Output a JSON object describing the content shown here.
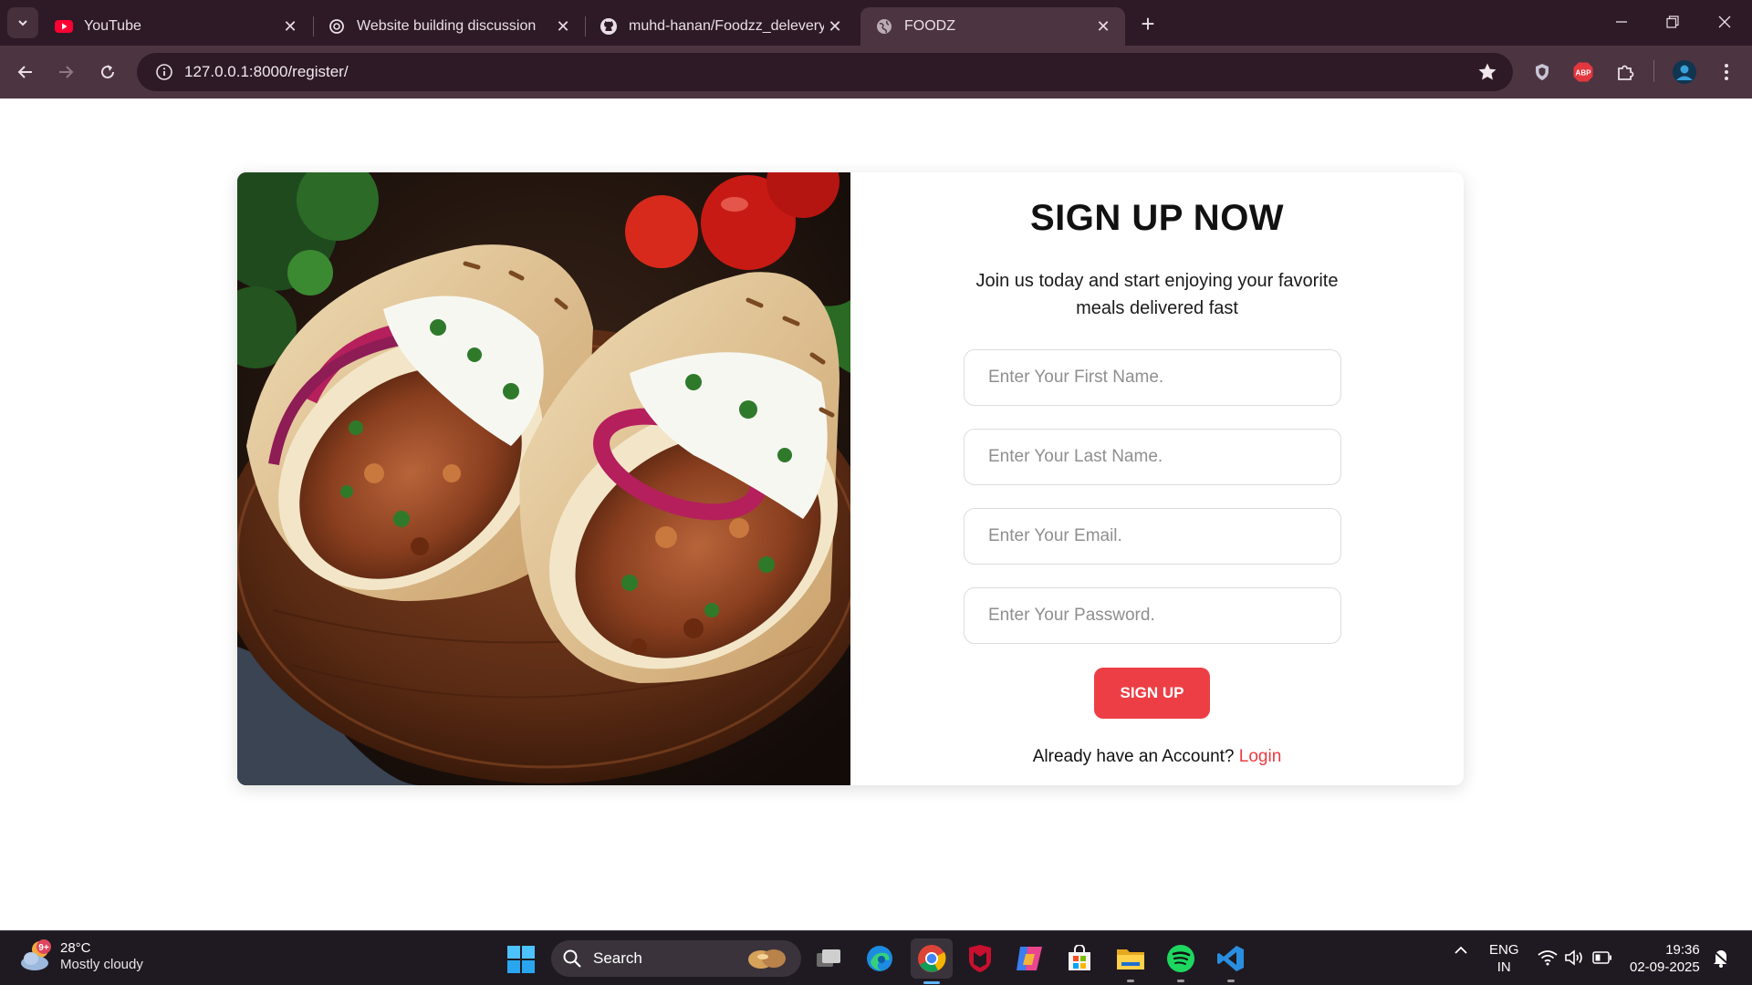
{
  "browser": {
    "tabs": [
      {
        "title": "YouTube",
        "icon": "youtube-icon"
      },
      {
        "title": "Website building discussion",
        "icon": "chatgpt-icon"
      },
      {
        "title": "muhd-hanan/Foodzz_delevery",
        "icon": "github-icon"
      },
      {
        "title": "FOODZ",
        "icon": "globe-icon",
        "active": true
      }
    ],
    "url": "127.0.0.1:8000/register/",
    "extensions": [
      "shield-extension-icon",
      "adblock-plus-icon",
      "extensions-puzzle-icon",
      "profile-avatar",
      "more-menu-icon"
    ],
    "abp_label": "ABP"
  },
  "page": {
    "title": "SIGN UP NOW",
    "subtitle": "Join us today and start enjoying your favorite meals delivered fast",
    "fields": {
      "first_name_placeholder": "Enter Your First Name.",
      "last_name_placeholder": "Enter Your Last Name.",
      "email_placeholder": "Enter Your Email.",
      "password_placeholder": "Enter Your Password."
    },
    "signup_button": "SIGN UP",
    "login_prompt": "Already have an Account?",
    "login_link": "Login",
    "colors": {
      "accent": "#ee3e45",
      "link": "#e93c42"
    },
    "image_subject": "chicken shawarma wraps on wooden board"
  },
  "taskbar": {
    "weather": {
      "temp": "28°C",
      "condition": "Mostly cloudy",
      "badge": "9+"
    },
    "search_label": "Search",
    "apps": [
      "task-view-icon",
      "edge-icon",
      "chrome-icon",
      "mcafee-icon",
      "copilot-icon",
      "microsoft-store-icon",
      "file-explorer-icon",
      "spotify-icon",
      "vscode-icon"
    ],
    "language": {
      "line1": "ENG",
      "line2": "IN"
    },
    "time": "19:36",
    "date": "02-09-2025"
  }
}
